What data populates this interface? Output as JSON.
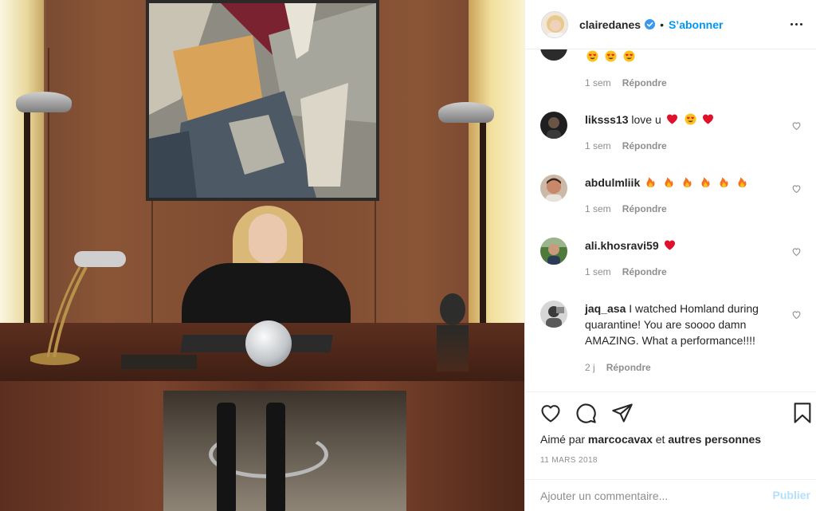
{
  "post": {
    "author": "clairedanes",
    "follow_label": "S’abonner",
    "separator": "•"
  },
  "comments": [
    {
      "username": "",
      "text": "",
      "emojis": [
        "heart-eyes-emoji",
        "heart-eyes-emoji",
        "heart-eyes-emoji"
      ],
      "age": "1 sem",
      "reply": "Répondre"
    },
    {
      "username": "liksss13",
      "text": "love u",
      "emojis": [
        "red-heart-emoji",
        "heart-eyes-emoji",
        "red-heart-emoji"
      ],
      "age": "1 sem",
      "reply": "Répondre"
    },
    {
      "username": "abdulmliik",
      "text": "",
      "emojis": [
        "fire-emoji",
        "fire-emoji",
        "fire-emoji",
        "fire-emoji",
        "fire-emoji",
        "fire-emoji"
      ],
      "age": "1 sem",
      "reply": "Répondre"
    },
    {
      "username": "ali.khosravi59",
      "text": "",
      "emojis": [
        "red-heart-emoji"
      ],
      "age": "1 sem",
      "reply": "Répondre"
    },
    {
      "username": "jaq_asa",
      "text": "I watched Homland during quarantine! You are soooo damn AMAZING. What a performance!!!!",
      "emojis": [],
      "age": "2 j",
      "reply": "Répondre"
    }
  ],
  "likes": {
    "prefix": "Aimé par",
    "user": "marcocavax",
    "conjunction": "et",
    "others": "autres personnes"
  },
  "date": "11 MARS 2018",
  "add_comment": {
    "placeholder": "Ajouter un commentaire...",
    "post_label": "Publier"
  },
  "colors": {
    "accent": "#0095f6",
    "text": "#262626",
    "muted": "#8e8e8e",
    "post_disabled": "#b2dffc"
  },
  "icons": [
    "verified-badge-icon",
    "more-options-icon",
    "heart-icon",
    "comment-icon",
    "share-icon",
    "bookmark-icon",
    "like-comment-icon"
  ]
}
